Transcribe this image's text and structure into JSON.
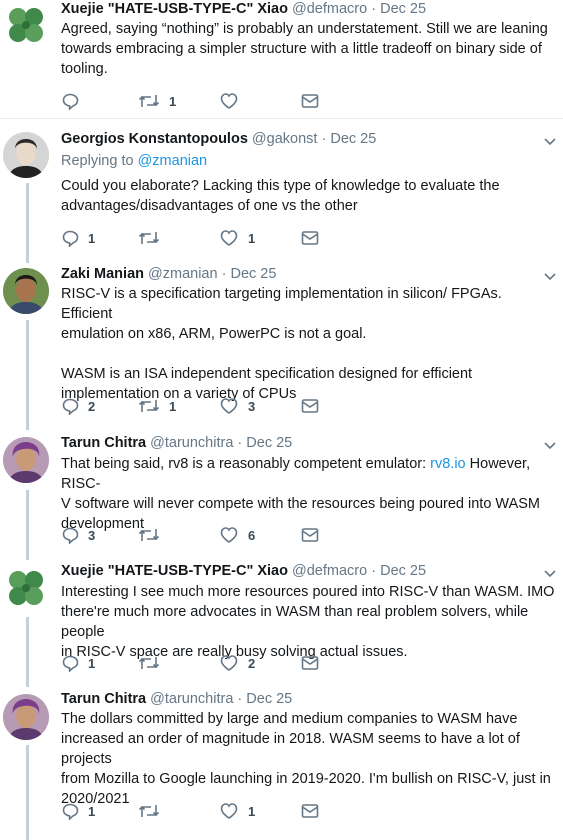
{
  "tweets": [
    {
      "name": "Xuejie \"HATE-USB-TYPE-C\" Xiao",
      "handle": "@defmacro",
      "dot": "·",
      "date": "Dec 25",
      "avatar": "clover-avatar",
      "replying_prefix": "",
      "replying_to": "",
      "text": "Agreed, saying “nothing” is probably an understatement. Still we are leaning\ntowards embracing a simpler structure with a little tradeoff on binary side of\ntooling.",
      "replies": "",
      "retweets": "1",
      "likes": ""
    },
    {
      "name": "Georgios Konstantopoulos",
      "handle": "@gakonst",
      "dot": "·",
      "date": "Dec 25",
      "avatar": "person-avatar",
      "replying_prefix": "Replying to",
      "replying_to": "@zmanian",
      "text": "Could you elaborate? Lacking this type of knowledge to evaluate the\nadvantages/disadvantages of one vs the other",
      "replies": "1",
      "retweets": "",
      "likes": "1"
    },
    {
      "name": "Zaki Manian",
      "handle": "@zmanian",
      "dot": "·",
      "date": "Dec 25",
      "avatar": "person-avatar",
      "replying_prefix": "",
      "replying_to": "",
      "text": "RISC-V is a specification targeting implementation in silicon/ FPGAs. Efficient\nemulation on x86, ARM, PowerPC is not a goal.\n\nWASM is an ISA independent specification designed for efficient\nimplementation on a variety of CPUs",
      "replies": "2",
      "retweets": "1",
      "likes": "3"
    },
    {
      "name": "Tarun Chitra",
      "handle": "@tarunchitra",
      "dot": "·",
      "date": "Dec 25",
      "avatar": "person-avatar",
      "replying_prefix": "",
      "replying_to": "",
      "text_before_link": "That being said, rv8 is a reasonably competent emulator: ",
      "text_link": "rv8.io",
      "text_after_link": " However, RISC-\nV software will never compete with the resources being poured into WASM\ndevelopment",
      "replies": "3",
      "retweets": "",
      "likes": "6"
    },
    {
      "name": "Xuejie \"HATE-USB-TYPE-C\" Xiao",
      "handle": "@defmacro",
      "dot": "·",
      "date": "Dec 25",
      "avatar": "clover-avatar",
      "replying_prefix": "",
      "replying_to": "",
      "text": "Interesting I see much more resources poured into RISC-V than WASM. IMO\nthere're much more advocates in WASM than real problem solvers, while people\nin RISC-V space are really busy solving actual issues.",
      "replies": "1",
      "retweets": "",
      "likes": "2"
    },
    {
      "name": "Tarun Chitra",
      "handle": "@tarunchitra",
      "dot": "·",
      "date": "Dec 25",
      "avatar": "person-avatar",
      "replying_prefix": "",
      "replying_to": "",
      "text": "The dollars committed by large and medium companies to WASM have\nincreased an order of magnitude in 2018. WASM seems to have a lot of projects\nfrom Mozilla to Google launching in 2019-2020. I'm bullish on RISC-V, just in\n2020/2021",
      "replies": "1",
      "retweets": "",
      "likes": "1"
    }
  ],
  "icons": {
    "reply": "reply-icon",
    "retweet": "retweet-icon",
    "like": "heart-icon",
    "dm": "envelope-icon",
    "caret": "chevron-down-icon"
  },
  "colors": {
    "link": "#1b95e0",
    "muted": "#657786",
    "icon": "#657786",
    "thread_line": "#c4cfd6",
    "divider": "#e6ecf0"
  }
}
